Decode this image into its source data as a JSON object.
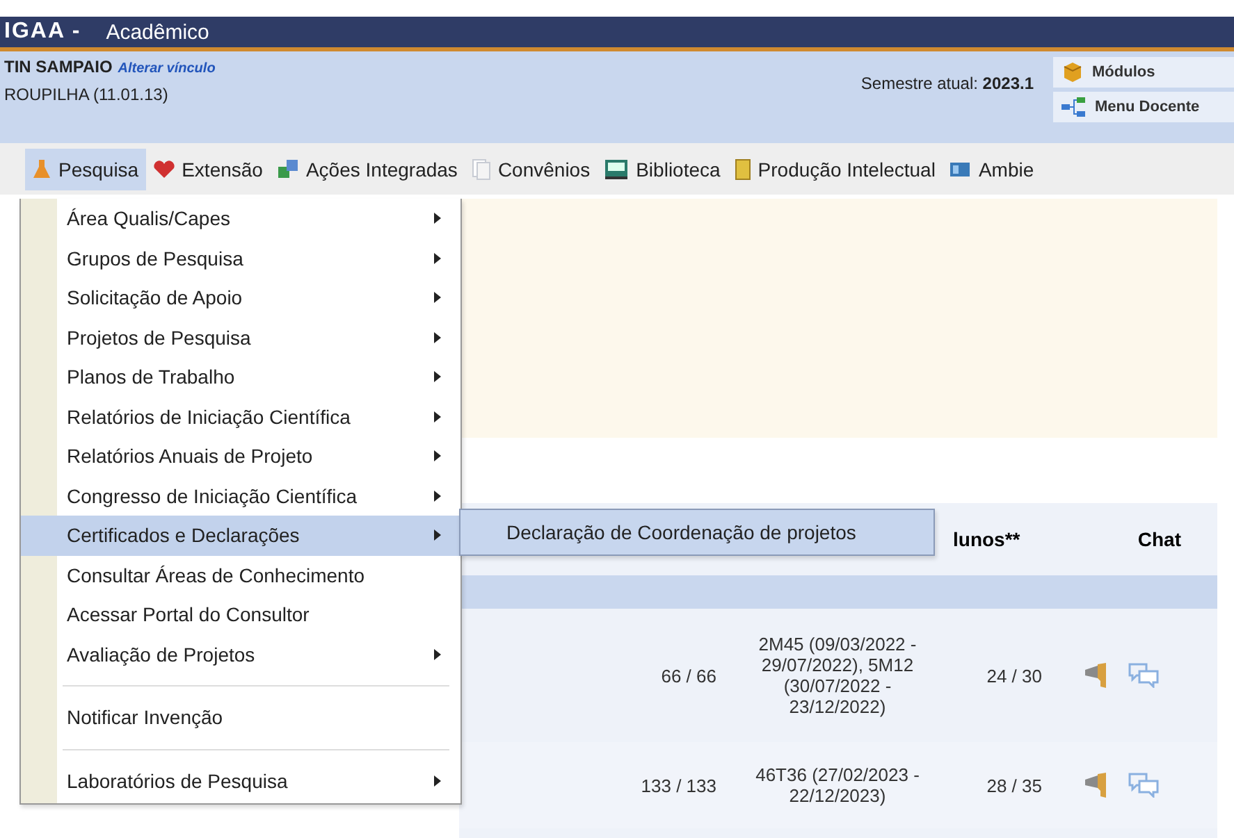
{
  "header": {
    "system": "IGAA -",
    "module": "Acadêmico"
  },
  "user_info": {
    "name": "TIN SAMPAIO",
    "change_link": "Alterar vínculo",
    "unit": "ROUPILHA (11.01.13)",
    "semester": "Semestre atual: **2023.1**"
  },
  "shortcuts": [
    {
      "label": "Módulos"
    },
    {
      "label": "Menu Docente"
    }
  ],
  "menu_bar": [
    {
      "label": "Pesquisa",
      "selected": true
    },
    {
      "label": "Extensão",
      "selected": false
    },
    {
      "label": "Ações Integradas",
      "selected": false
    },
    {
      "label": "Convênios",
      "selected": false
    },
    {
      "label": "Biblioteca",
      "selected": false
    },
    {
      "label": "Produção Intelectual",
      "selected": false
    },
    {
      "label": "Ambie",
      "selected": false
    }
  ],
  "dropdown": [
    {
      "kind": "item",
      "label": "Área Qualis/Capes",
      "has_submenu": true,
      "selected": false
    },
    {
      "kind": "item",
      "label": "Grupos de Pesquisa",
      "has_submenu": true,
      "selected": false
    },
    {
      "kind": "item",
      "label": "Solicitação de Apoio",
      "has_submenu": true,
      "selected": false
    },
    {
      "kind": "item",
      "label": "Projetos de Pesquisa",
      "has_submenu": true,
      "selected": false
    },
    {
      "kind": "item",
      "label": "Planos de Trabalho",
      "has_submenu": true,
      "selected": false
    },
    {
      "kind": "item",
      "label": "Relatórios de Iniciação Científica",
      "has_submenu": true,
      "selected": false
    },
    {
      "kind": "item",
      "label": "Relatórios Anuais de Projeto",
      "has_submenu": true,
      "selected": false
    },
    {
      "kind": "item",
      "label": "Congresso de Iniciação Científica",
      "has_submenu": true,
      "selected": false
    },
    {
      "kind": "item",
      "label": "Certificados e Declarações",
      "has_submenu": true,
      "selected": true
    },
    {
      "kind": "item",
      "label": "Consultar Áreas de Conhecimento",
      "has_submenu": false,
      "selected": false
    },
    {
      "kind": "item",
      "label": "Acessar Portal do Consultor",
      "has_submenu": false,
      "selected": false
    },
    {
      "kind": "item",
      "label": "Avaliação de Projetos",
      "has_submenu": true,
      "selected": false
    },
    {
      "kind": "separator"
    },
    {
      "kind": "item",
      "label": "Notificar Invenção",
      "has_submenu": false,
      "selected": false
    },
    {
      "kind": "separator"
    },
    {
      "kind": "item",
      "label": "Laboratórios de Pesquisa",
      "has_submenu": true,
      "selected": false
    }
  ],
  "submenu": [
    {
      "label": "Declaração de Coordenação de projetos"
    }
  ],
  "table": {
    "columns": [
      "lunos**",
      "Chat"
    ],
    "rows": [
      {
        "column_1": "66 / 66",
        "column_2": "2M45 (09/03/2022 - 29/07/2022), 5M12 (30/07/2022 - 23/12/2022)",
        "column_3": "24 / 30"
      },
      {
        "column_1": "133 / 133",
        "column_2": "46T36 (27/02/2023 - 22/12/2023)",
        "column_3": "28 / 35"
      }
    ]
  }
}
